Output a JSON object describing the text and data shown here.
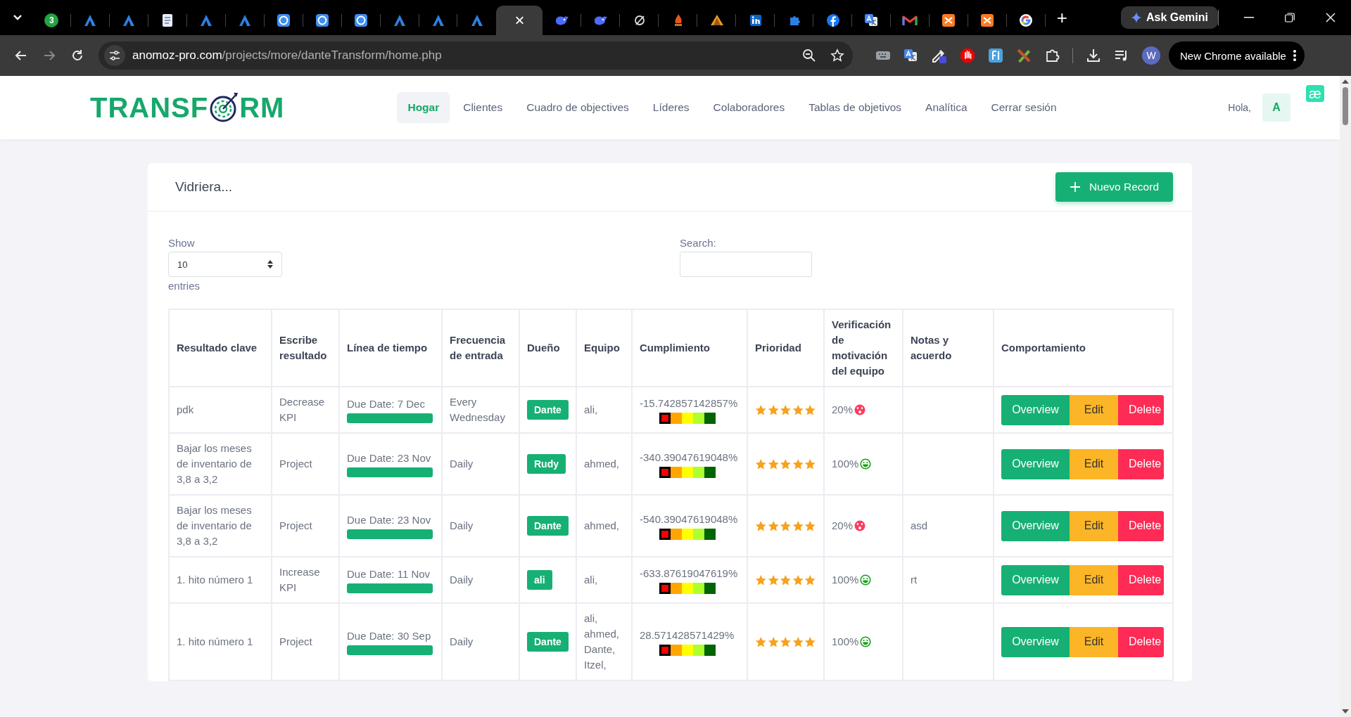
{
  "browser": {
    "tabs": [
      {
        "kind": "chat",
        "badge": "3",
        "selected": false
      },
      {
        "kind": "triangle",
        "selected": false
      },
      {
        "kind": "triangle",
        "selected": false
      },
      {
        "kind": "doc",
        "selected": false
      },
      {
        "kind": "triangle",
        "selected": false
      },
      {
        "kind": "triangle",
        "selected": false
      },
      {
        "kind": "app",
        "selected": false
      },
      {
        "kind": "app",
        "selected": false
      },
      {
        "kind": "app",
        "selected": false
      },
      {
        "kind": "triangle",
        "selected": false
      },
      {
        "kind": "triangle",
        "selected": false
      },
      {
        "kind": "triangle",
        "selected": false
      },
      {
        "kind": "blank",
        "close": "×",
        "selected": true
      },
      {
        "kind": "whale",
        "selected": false
      },
      {
        "kind": "whale",
        "selected": false
      },
      {
        "kind": "slash",
        "selected": false
      },
      {
        "kind": "flame",
        "selected": false
      },
      {
        "kind": "peak",
        "selected": false
      },
      {
        "kind": "square-blue",
        "selected": false
      },
      {
        "kind": "puzzle",
        "selected": false
      },
      {
        "kind": "circle-blue",
        "selected": false
      },
      {
        "kind": "translate",
        "selected": false
      },
      {
        "kind": "mail",
        "selected": false
      },
      {
        "kind": "square-orange",
        "selected": false
      },
      {
        "kind": "square-orange",
        "selected": false
      },
      {
        "kind": "ring",
        "selected": false
      }
    ],
    "new_tab": "+",
    "ask_gemini": "Ask Gemini",
    "url": {
      "host": "anomoz-pro.com",
      "path": "/projects/more/danteTransform/home.php"
    },
    "extensions": [
      {
        "kind": "keyboard"
      },
      {
        "kind": "translate"
      },
      {
        "kind": "eyedropper"
      },
      {
        "kind": "stop-hand"
      },
      {
        "kind": "bracket"
      },
      {
        "kind": "pencil"
      },
      {
        "kind": "puzzle"
      }
    ],
    "profile": "W",
    "update_notice": "New Chrome available"
  },
  "header": {
    "logo": {
      "before": "TRANSF",
      "after": "RM"
    },
    "nav": [
      {
        "label": "Hogar",
        "selected": true
      },
      {
        "label": "Clientes",
        "selected": false
      },
      {
        "label": "Cuadro de objectives",
        "selected": false
      },
      {
        "label": "Líderes",
        "selected": false
      },
      {
        "label": "Colaboradores",
        "selected": false
      },
      {
        "label": "Tablas de objetivos",
        "selected": false
      },
      {
        "label": "Analítica",
        "selected": false
      },
      {
        "label": "Cerrar sesión",
        "selected": false
      }
    ],
    "greeting": "Hola,",
    "avatar": "A",
    "badge": "æ"
  },
  "card": {
    "title": "Vidriera...",
    "new_button": "Nuevo Record",
    "show_label": "Show",
    "page_size": "10",
    "entries_label": "entries",
    "search_label": "Search:",
    "table": {
      "columns": [
        "Resultado clave",
        "Escribe resultado",
        "Línea de tiempo",
        "Frecuencia de entrada",
        "Dueño",
        "Equipo",
        "Cumplimiento",
        "Prioridad",
        "Verificación de motivación del equipo",
        "Notas y acuerdo",
        "Comportamiento"
      ],
      "rows": [
        {
          "result": "pdk",
          "type": "Decrease KPI",
          "due": "Due Date: 7 Dec",
          "level": 1,
          "frequency": "Every Wednesday",
          "owner": "Dante",
          "team": "ali,",
          "compliance": "-15.742857142857%",
          "meter": [
            {
              "color": "#ff0000",
              "selected": true
            },
            {
              "color": "#ffa500",
              "selected": false
            },
            {
              "color": "#ffff00",
              "selected": false
            },
            {
              "color": "#adff2f",
              "selected": false
            },
            {
              "color": "#006400",
              "selected": false
            }
          ],
          "stars": 5,
          "motivation": "20%",
          "kind": "sad",
          "notes": "",
          "actions": [
            {
              "label": "Overview",
              "kind": "view"
            },
            {
              "label": "Edit",
              "kind": "edit"
            },
            {
              "label": "Delete",
              "kind": "delete"
            }
          ]
        },
        {
          "result": "Bajar los meses de inventario de 3,8 a 3,2",
          "type": "Project",
          "due": "Due Date: 23 Nov",
          "level": 1,
          "frequency": "Daily",
          "owner": "Rudy",
          "team": "ahmed,",
          "compliance": "-340.39047619048%",
          "meter": [
            {
              "color": "#ff0000",
              "selected": true
            },
            {
              "color": "#ffa500",
              "selected": false
            },
            {
              "color": "#ffff00",
              "selected": false
            },
            {
              "color": "#adff2f",
              "selected": false
            },
            {
              "color": "#006400",
              "selected": false
            }
          ],
          "stars": 5,
          "motivation": "100%",
          "kind": "happy",
          "notes": "",
          "actions": [
            {
              "label": "Overview",
              "kind": "view"
            },
            {
              "label": "Edit",
              "kind": "edit"
            },
            {
              "label": "Delete",
              "kind": "delete"
            }
          ]
        },
        {
          "result": "Bajar los meses de inventario de 3,8 a 3,2",
          "type": "Project",
          "due": "Due Date: 23 Nov",
          "level": 1,
          "frequency": "Daily",
          "owner": "Dante",
          "team": "ahmed,",
          "compliance": "-540.39047619048%",
          "meter": [
            {
              "color": "#ff0000",
              "selected": true
            },
            {
              "color": "#ffa500",
              "selected": false
            },
            {
              "color": "#ffff00",
              "selected": false
            },
            {
              "color": "#adff2f",
              "selected": false
            },
            {
              "color": "#006400",
              "selected": false
            }
          ],
          "stars": 5,
          "motivation": "20%",
          "kind": "sad",
          "notes": "asd",
          "actions": [
            {
              "label": "Overview",
              "kind": "view"
            },
            {
              "label": "Edit",
              "kind": "edit"
            },
            {
              "label": "Delete",
              "kind": "delete"
            }
          ]
        },
        {
          "result": "1. hito número 1",
          "type": "Increase KPI",
          "due": "Due Date: 11 Nov",
          "level": 1,
          "frequency": "Daily",
          "owner": "ali",
          "team": "ali,",
          "compliance": "-633.87619047619%",
          "meter": [
            {
              "color": "#ff0000",
              "selected": true
            },
            {
              "color": "#ffa500",
              "selected": false
            },
            {
              "color": "#ffff00",
              "selected": false
            },
            {
              "color": "#adff2f",
              "selected": false
            },
            {
              "color": "#006400",
              "selected": false
            }
          ],
          "stars": 5,
          "motivation": "100%",
          "kind": "happy",
          "notes": "rt",
          "actions": [
            {
              "label": "Overview",
              "kind": "view"
            },
            {
              "label": "Edit",
              "kind": "edit"
            },
            {
              "label": "Delete",
              "kind": "delete"
            }
          ]
        },
        {
          "result": "1. hito número 1",
          "type": "Project",
          "due": "Due Date: 30 Sep",
          "level": 1,
          "frequency": "Daily",
          "owner": "Dante",
          "team": "ali, ahmed, Dante, Itzel,",
          "compliance": "28.571428571429%",
          "meter": [
            {
              "color": "#ff0000",
              "selected": true
            },
            {
              "color": "#ffa500",
              "selected": false
            },
            {
              "color": "#ffff00",
              "selected": false
            },
            {
              "color": "#adff2f",
              "selected": false
            },
            {
              "color": "#006400",
              "selected": false
            }
          ],
          "stars": 5,
          "motivation": "100%",
          "kind": "happy",
          "notes": "",
          "actions": [
            {
              "label": "Overview",
              "kind": "view"
            },
            {
              "label": "Edit",
              "kind": "edit"
            },
            {
              "label": "Delete",
              "kind": "delete"
            }
          ]
        }
      ]
    }
  }
}
